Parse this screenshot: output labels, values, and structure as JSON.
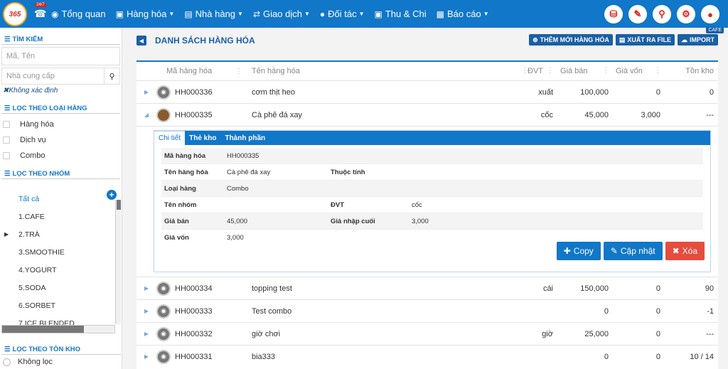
{
  "header": {
    "logo_text": "365",
    "phone_badge": "24/7",
    "nav": [
      {
        "label": "Tổng quan",
        "icon": "dashboard-icon",
        "dropdown": false
      },
      {
        "label": "Hàng hóa",
        "icon": "cube-icon",
        "dropdown": true
      },
      {
        "label": "Nhà hàng",
        "icon": "building-icon",
        "dropdown": true
      },
      {
        "label": "Giao dịch",
        "icon": "exchange-icon",
        "dropdown": true
      },
      {
        "label": "Đối tác",
        "icon": "users-icon",
        "dropdown": true
      },
      {
        "label": "Thu & Chi",
        "icon": "money-icon",
        "dropdown": false
      },
      {
        "label": "Báo cáo",
        "icon": "chart-icon",
        "dropdown": true
      }
    ],
    "right_icons": [
      "cart-icon",
      "edit-icon",
      "map-marker-icon",
      "gear-icon",
      "user-icon"
    ],
    "store_tag": "CAFE"
  },
  "sidebar": {
    "search_title": "TÌM KIẾM",
    "search_placeholder": "Mã, Tên",
    "supplier_placeholder": "Nhà cung cấp",
    "unknown_label": "Không xác định",
    "type_title": "LỌC THEO LOẠI HÀNG",
    "types": [
      "Hàng hóa",
      "Dịch vụ",
      "Combo"
    ],
    "group_title": "LỌC THEO NHÓM",
    "groups": [
      "Tất cả",
      "1.CAFE",
      "2.TRÀ",
      "3.SMOOTHIE",
      "4.YOGURT",
      "5.SODA",
      "6.SORBET",
      "7.ICE BLENDED"
    ],
    "stock_title": "LỌC THEO TỒN KHO",
    "stock_option": "Không lọc"
  },
  "main": {
    "title": "DANH SÁCH HÀNG HÓA",
    "buttons": {
      "add": "THÊM MỚI HÀNG HÓA",
      "export": "XUẤT RA FILE",
      "import": "IMPORT"
    },
    "columns": [
      "Mã hàng hóa",
      "Tên hàng hóa",
      "ĐVT",
      "Giá bán",
      "Giá vốn",
      "Tồn kho"
    ],
    "rows": [
      {
        "code": "HH000336",
        "name": "cơm thịt heo",
        "unit": "xuất",
        "price": "100,000",
        "cost": "0",
        "stock": "0"
      },
      {
        "code": "HH000335",
        "name": "Cà phê đá xay",
        "unit": "cốc",
        "price": "45,000",
        "cost": "3,000",
        "stock": "---"
      },
      {
        "code": "HH000334",
        "name": "topping test",
        "unit": "cái",
        "price": "150,000",
        "cost": "0",
        "stock": "90"
      },
      {
        "code": "HH000333",
        "name": "Test combo",
        "unit": "",
        "price": "0",
        "cost": "0",
        "stock": "-1"
      },
      {
        "code": "HH000332",
        "name": "giờ chơi",
        "unit": "giờ",
        "price": "25,000",
        "cost": "0",
        "stock": "---"
      },
      {
        "code": "HH000331",
        "name": "bia333",
        "unit": "",
        "price": "0",
        "cost": "0",
        "stock": "10 / 14"
      }
    ],
    "detail": {
      "tabs": [
        "Chi tiết",
        "Thẻ kho",
        "Thành phần"
      ],
      "code_label": "Mã hàng hóa",
      "code": "HH000335",
      "name_label": "Tên hàng hóa",
      "name": "Cà phê đá xay",
      "attr_label": "Thuộc tính",
      "type_label": "Loại hàng",
      "type": "Combo",
      "group_label": "Tên nhóm",
      "unit_label": "ĐVT",
      "unit": "cốc",
      "price_label": "Giá bán",
      "price": "45,000",
      "last_import_label": "Giá nhập cuối",
      "last_import": "3,000",
      "cost_label": "Giá vốn",
      "cost": "3,000",
      "copy": "Copy",
      "update": "Cập nhật",
      "delete": "Xóa"
    }
  }
}
